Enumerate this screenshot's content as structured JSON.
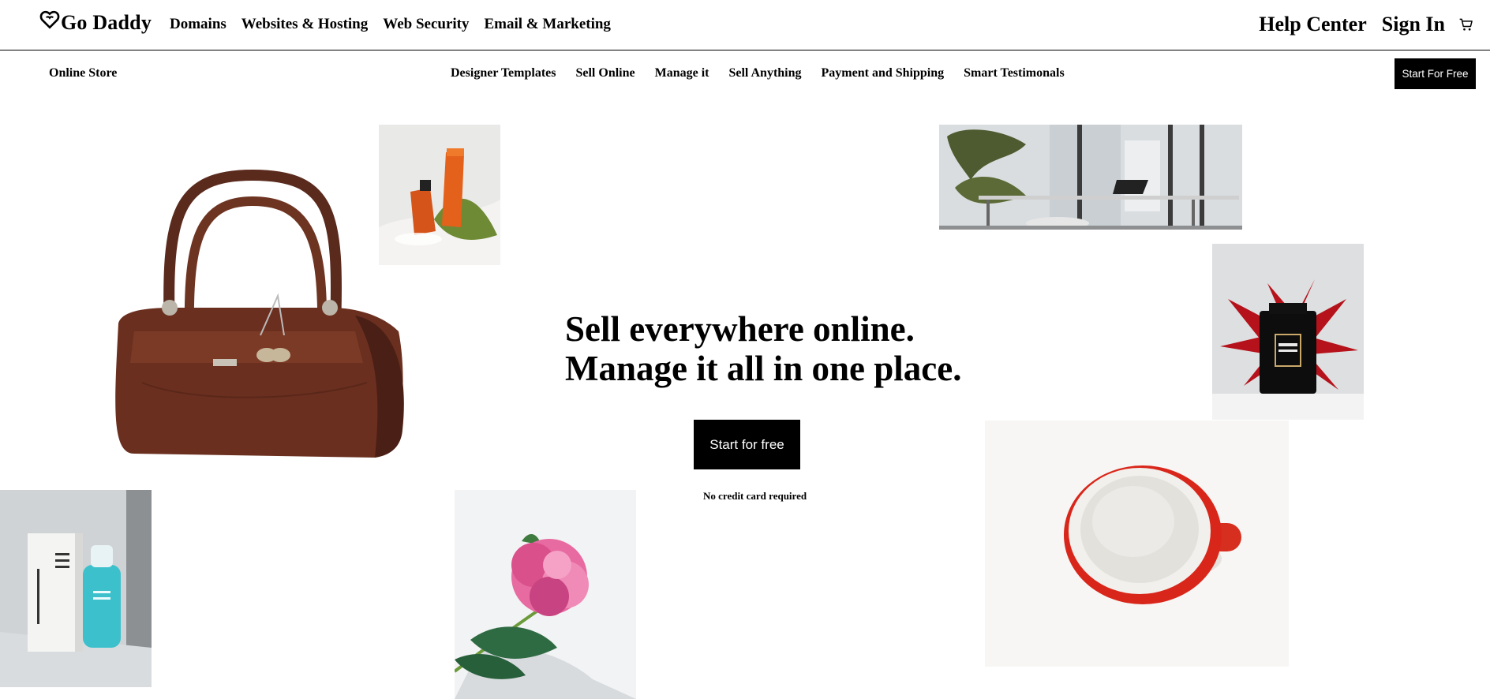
{
  "header": {
    "logo_text": "Go Daddy",
    "nav": [
      "Domains",
      "Websites & Hosting",
      "Web Security",
      "Email & Marketing"
    ],
    "help_center": "Help Center",
    "sign_in": "Sign In"
  },
  "subheader": {
    "title": "Online Store",
    "nav": [
      "Designer Templates",
      "Sell Online",
      "Manage it",
      "Sell Anything",
      "Payment and Shipping",
      "Smart Testimonals"
    ],
    "cta": "Start For Free"
  },
  "hero": {
    "title_line1": "Sell everywhere online.",
    "title_line2": "Manage it all in one place.",
    "cta": "Start for free",
    "note": "No credit card required"
  },
  "icons": {
    "logo": "heart-outline-icon",
    "cart": "shopping-cart-icon"
  },
  "colors": {
    "primary": "#000000",
    "background": "#ffffff"
  }
}
